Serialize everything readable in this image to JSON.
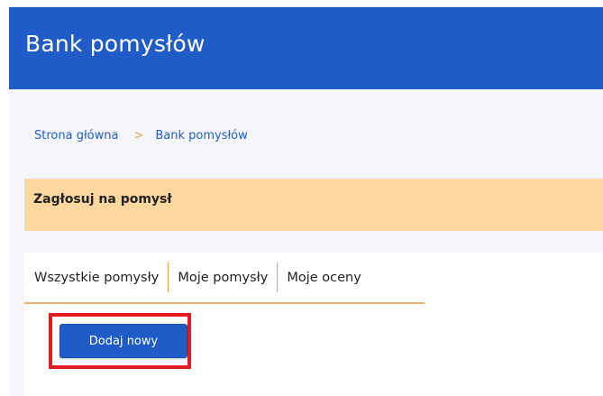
{
  "header": {
    "title": "Bank pomysłów"
  },
  "breadcrumb": {
    "items": [
      "Strona główna",
      "Bank pomysłów"
    ],
    "separator": ">"
  },
  "notice": {
    "text": "Zagłosuj na pomysł"
  },
  "tabs": [
    {
      "label": "Wszystkie pomysły",
      "active": true
    },
    {
      "label": "Moje pomysły",
      "active": false
    },
    {
      "label": "Moje oceny",
      "active": false
    }
  ],
  "actions": {
    "add_label": "Dodaj nowy"
  },
  "colors": {
    "header_bg": "#1f5cc8",
    "notice_bg": "#fcd79e",
    "accent": "#f0a04b",
    "highlight": "#e31b23",
    "link": "#1f5cc8"
  }
}
